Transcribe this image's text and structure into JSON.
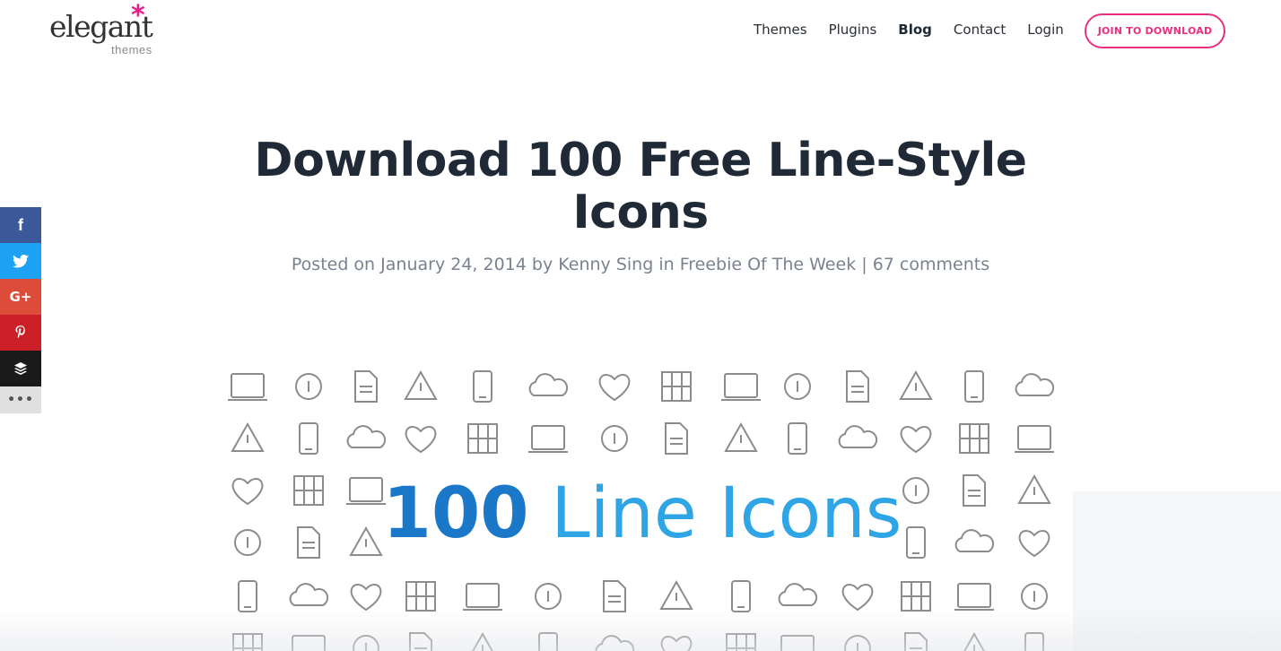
{
  "logo": {
    "word": "elegant",
    "sub": "themes",
    "star": "*"
  },
  "nav": {
    "items": [
      "Themes",
      "Plugins",
      "Blog",
      "Contact",
      "Login"
    ],
    "join": "JOIN TO DOWNLOAD"
  },
  "post": {
    "title_line1": "Download 100 Free Line-Style",
    "title_line2": "Icons",
    "meta_prefix": "Posted on",
    "date": "January 24, 2014",
    "by": "by",
    "author": "Kenny Sing",
    "in": "in",
    "category": "Freebie Of The Week",
    "sep": "|",
    "comments": "67 comments"
  },
  "social": {
    "buttons": [
      {
        "name": "facebook",
        "glyph": "f",
        "color": "#3b5998"
      },
      {
        "name": "twitter",
        "glyph": "🐦",
        "color": "#1da1f2"
      },
      {
        "name": "google-plus",
        "glyph": "G+",
        "color": "#dd4b39"
      },
      {
        "name": "pinterest",
        "glyph": "P",
        "color": "#cb2027"
      },
      {
        "name": "buffer",
        "glyph": "≡",
        "color": "#1a1a1a"
      },
      {
        "name": "more",
        "glyph": "•••",
        "color": "#e0e0e0"
      }
    ]
  },
  "feature": {
    "banner_number": "100",
    "banner_text": "Line Icons",
    "icon_color": "#8c8c8c",
    "number_color": "#1b78c9",
    "text_color": "#2fa5e6"
  }
}
